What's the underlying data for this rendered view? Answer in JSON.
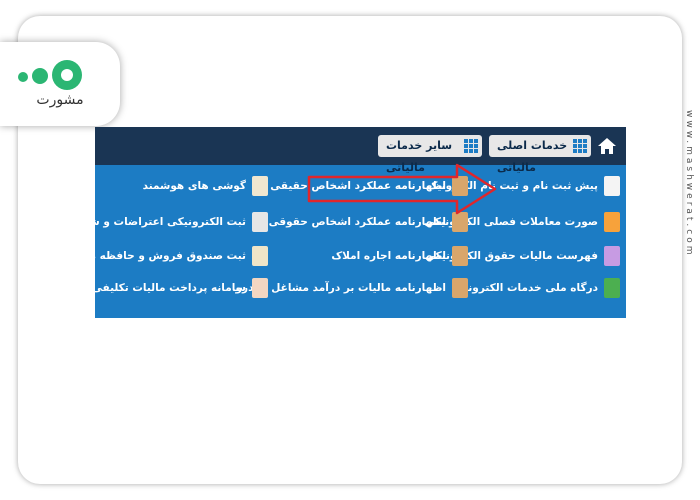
{
  "logo": {
    "text": "مشورت"
  },
  "watermark": "www.mashwerat.com",
  "menu": {
    "tabs": [
      {
        "label": "خدمات اصلی مالیاتی"
      },
      {
        "label": "سایر خدمات مالیاتی"
      }
    ],
    "columns": [
      {
        "items": [
          {
            "label": "پیش ثبت نام و ثبت نام الکترونیک",
            "icon": "registration-icon",
            "color": "#f4f4f4"
          },
          {
            "label": "صورت معاملات فصلی الکترونیکی",
            "icon": "handshake-icon",
            "color": "#f7a23b"
          },
          {
            "label": "فهرست مالیات حقوق الکترونیکی",
            "icon": "document-list-icon",
            "color": "#c79be3"
          },
          {
            "label": "درگاه ملی خدمات الکترونیک",
            "icon": "portal-icon",
            "color": "#4caf50"
          }
        ]
      },
      {
        "items": [
          {
            "label": "اظهارنامه عملکرد اشخاص حقیقی",
            "icon": "tax-return-icon",
            "color": "#d9a66b"
          },
          {
            "label": "اظهارنامه عملکرد اشخاص حقوقی",
            "icon": "tax-return-icon",
            "color": "#d9a66b"
          },
          {
            "label": "اظهارنامه اجاره املاک",
            "icon": "tax-return-icon",
            "color": "#d9a66b"
          },
          {
            "label": "اظهارنامه مالیات بر درآمد مشاغل خودرو",
            "icon": "tax-return-icon",
            "color": "#d9a66b"
          }
        ]
      },
      {
        "items": [
          {
            "label": "گوشی های هوشمند",
            "icon": "smartphone-icon",
            "color": "#f0e7d0"
          },
          {
            "label": "ثبت الکترونیکی اعتراضات و شکایات",
            "icon": "complaint-icon",
            "color": "#e6e6e6"
          },
          {
            "label": "ثبت صندوق فروش و حافظه مالیاتی",
            "icon": "cash-register-icon",
            "color": "#efe5c8"
          },
          {
            "label": "سامانه پرداخت مالیات تکلیفی پزشکان",
            "icon": "doctor-icon",
            "color": "#f2d6c2"
          }
        ]
      }
    ]
  },
  "colors": {
    "panel": "#1c7cc4",
    "topbar": "#1a3554",
    "arrow": "#e0262b"
  }
}
